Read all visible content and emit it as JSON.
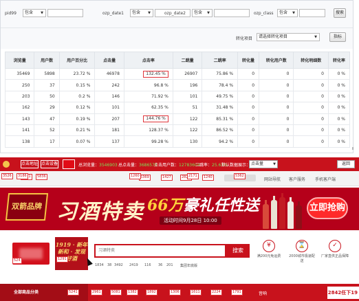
{
  "filters": {
    "pid_label": "pid99",
    "pid_value": "包含",
    "date1_label": "ozp_date1",
    "date1_value": "包含",
    "date2_label": "ozp_date2",
    "date2_value": "包含",
    "class_label": "ozp_class",
    "class_value": "包含",
    "search_btn": "搜索",
    "conv_label": "转化项目",
    "conv_value": "请选择转化项目",
    "metric_btn": "指标"
  },
  "table": {
    "headers": [
      "浏览量",
      "用户数",
      "用户百分比",
      "点击量",
      "点击率",
      "二跳量",
      "二跳率",
      "转化量",
      "转化用户数",
      "转化明细数",
      "转化率"
    ],
    "rows": [
      [
        "35469",
        "5898",
        "23.72 %",
        "46978",
        "132.45 %",
        "26907",
        "75.86 %",
        "0",
        "0",
        "0",
        "0 %"
      ],
      [
        "250",
        "37",
        "0.15 %",
        "242",
        "96.8 %",
        "196",
        "78.4 %",
        "0",
        "0",
        "0",
        "0 %"
      ],
      [
        "203",
        "50",
        "0.2 %",
        "146",
        "71.92 %",
        "101",
        "49.75 %",
        "0",
        "0",
        "0",
        "0 %"
      ],
      [
        "162",
        "29",
        "0.12 %",
        "101",
        "62.35 %",
        "51",
        "31.48 %",
        "0",
        "0",
        "0",
        "0 %"
      ],
      [
        "143",
        "47",
        "0.19 %",
        "207",
        "144.76 %",
        "122",
        "85.31 %",
        "0",
        "0",
        "0",
        "0 %"
      ],
      [
        "141",
        "52",
        "0.21 %",
        "181",
        "128.37 %",
        "122",
        "86.52 %",
        "0",
        "0",
        "0",
        "0 %"
      ],
      [
        "138",
        "17",
        "0.07 %",
        "137",
        "99.28 %",
        "130",
        "94.2 %",
        "0",
        "0",
        "0",
        "0 %"
      ]
    ],
    "highlighted": [
      "0-4",
      "4-4"
    ]
  },
  "mall": {
    "topbar": {
      "btn1": "点击地址",
      "btn2": "点击设备",
      "stat1_label": "总浏览量：",
      "stat1_value": "3546903",
      "stat2_label": "总点击量：",
      "stat2_value": "3686575",
      "stat3_label": "点击用户数：",
      "stat3_value": "12783604",
      "stat4_label": "二跳率：",
      "stat4_value": "25.63%",
      "view_label": "默认数据展示：",
      "view_value": "点击量",
      "right_btn": "返回"
    },
    "nav": {
      "hotkeys_left": [
        "2621",
        "5836"
      ],
      "hotkeys_mid": [
        "5369",
        "1427",
        "2827",
        "1240"
      ],
      "links": [
        "网站导航",
        "客户服务",
        "手机客户端"
      ],
      "left_edge": "6536"
    },
    "banner": {
      "left_badge": "双箭品牌",
      "title": "习酒特卖",
      "mid_big_prefix": "",
      "mid_big_num": "66万",
      "mid_big_text": "豪礼任性送",
      "mid_sub": "活动时间9月28日 10:00",
      "buy": "立即抢购",
      "tickers": [
        "3526",
        "3186",
        "1260",
        "2171",
        "5362",
        "3581",
        "2826",
        "4921",
        "3418"
      ]
    },
    "search": {
      "logo2_text": "1919 · 新年新和 · 发现好酒",
      "hotkeys": [
        "524",
        "1291"
      ],
      "placeholder": "习酒特卖",
      "button": "搜索",
      "keywords": [
        "1834",
        "38",
        "3492",
        "2419",
        "116",
        "36",
        "201",
        "集团年底版"
      ],
      "services": [
        {
          "icon": "¥",
          "label": "满200元免运费"
        },
        {
          "icon": "⌛",
          "label": "2000城市极速配送"
        },
        {
          "icon": "✓",
          "label": "厂家直供正品保障"
        }
      ]
    },
    "category": {
      "all_label": "全部商品分类",
      "items": [
        "5241",
        "2961",
        "5081",
        "1382",
        "1892",
        "1306",
        "1611",
        "2224",
        "1791",
        "音响"
      ],
      "right": "2842任下19"
    }
  }
}
